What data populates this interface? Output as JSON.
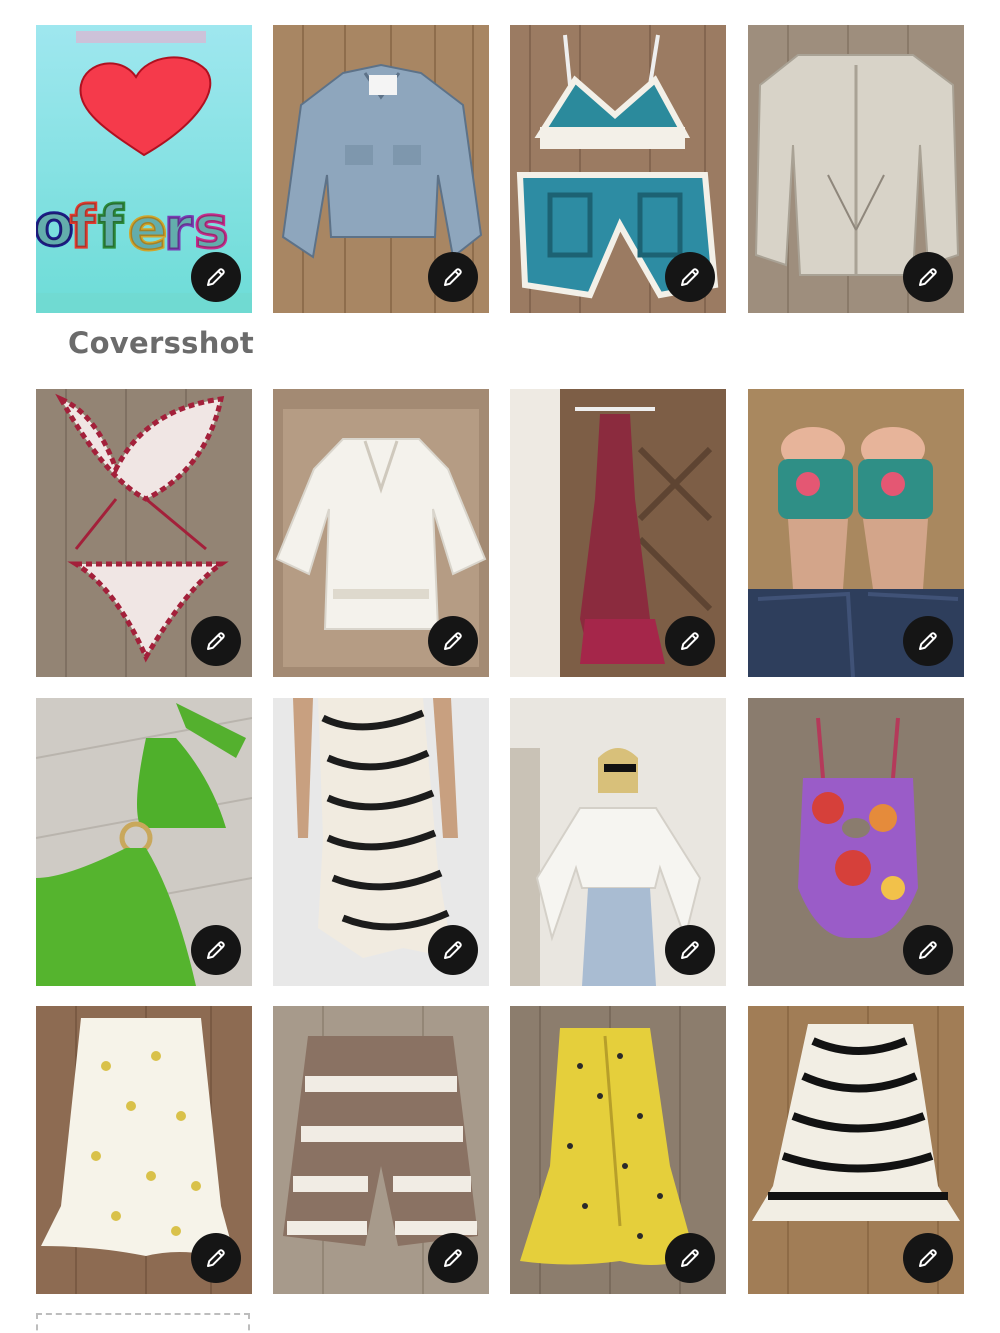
{
  "cover": {
    "label": "Coversshot",
    "offers_text": "offers"
  },
  "listings": [
    {
      "name": "offers-coverphoto",
      "description": "offers cover image"
    },
    {
      "name": "denim-jacket"
    },
    {
      "name": "crochet-set"
    },
    {
      "name": "knit-cardigan"
    },
    {
      "name": "striped-bikini"
    },
    {
      "name": "white-tunic"
    },
    {
      "name": "floral-slip-dress"
    },
    {
      "name": "embroidered-slides"
    },
    {
      "name": "green-crochet-top"
    },
    {
      "name": "zebra-midi-skirt"
    },
    {
      "name": "white-eyelet-top"
    },
    {
      "name": "floral-swimsuit"
    },
    {
      "name": "floral-midi-skirt"
    },
    {
      "name": "knit-shorts"
    },
    {
      "name": "yellow-ruched-skirt"
    },
    {
      "name": "zebra-mini-skirt"
    }
  ],
  "icons": {
    "edit": "pencil-icon",
    "heart": "heart-icon"
  },
  "colors": {
    "edit_button": "#151515",
    "cover_bg": "#7fe0e0",
    "heart": "#f53a4b",
    "label": "#6b6b6b"
  }
}
